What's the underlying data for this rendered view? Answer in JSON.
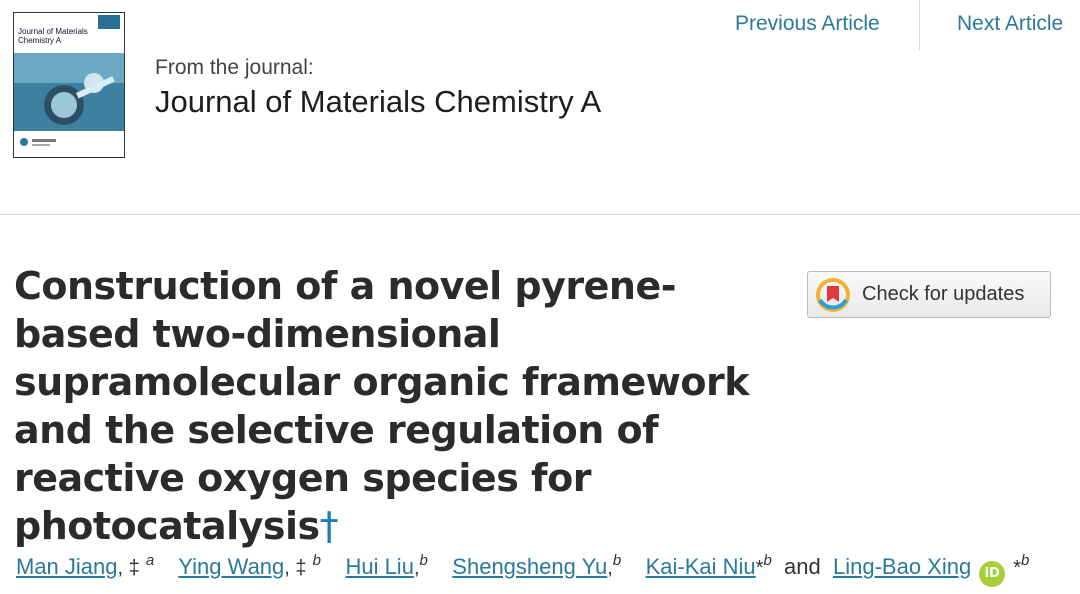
{
  "journal": {
    "cover_title": "Journal of Materials Chemistry A",
    "from_label": "From the journal:",
    "name": "Journal of Materials Chemistry A"
  },
  "nav": {
    "prev_label": "Previous Article",
    "next_label": "Next Article"
  },
  "article": {
    "title": "Construction of a novel pyrene-based two-dimensional supramolecular organic framework and the selective regulation of reactive oxygen species for photocatalysis",
    "title_dagger": "†"
  },
  "check_updates": {
    "label": "Check for updates"
  },
  "authors": [
    {
      "name": "Man Jiang",
      "marks": ", ‡",
      "affil": "a"
    },
    {
      "name": "Ying Wang",
      "marks": ", ‡",
      "affil": "b"
    },
    {
      "name": "Hui Liu",
      "marks": ",",
      "affil": "b"
    },
    {
      "name": "Shengsheng Yu",
      "marks": ",",
      "affil": "b"
    },
    {
      "name": "Kai-Kai Niu",
      "marks": "*",
      "affil": "b"
    },
    {
      "conjunction": "and"
    },
    {
      "name": "Ling-Bao Xing",
      "marks": "*",
      "affil": "b",
      "orcid_label": "iD"
    }
  ],
  "colors": {
    "link": "#2a7a99",
    "title": "#2b2b2b",
    "orcid": "#a6ce39"
  },
  "icons": [
    "check-for-updates-icon",
    "orcid-icon"
  ]
}
